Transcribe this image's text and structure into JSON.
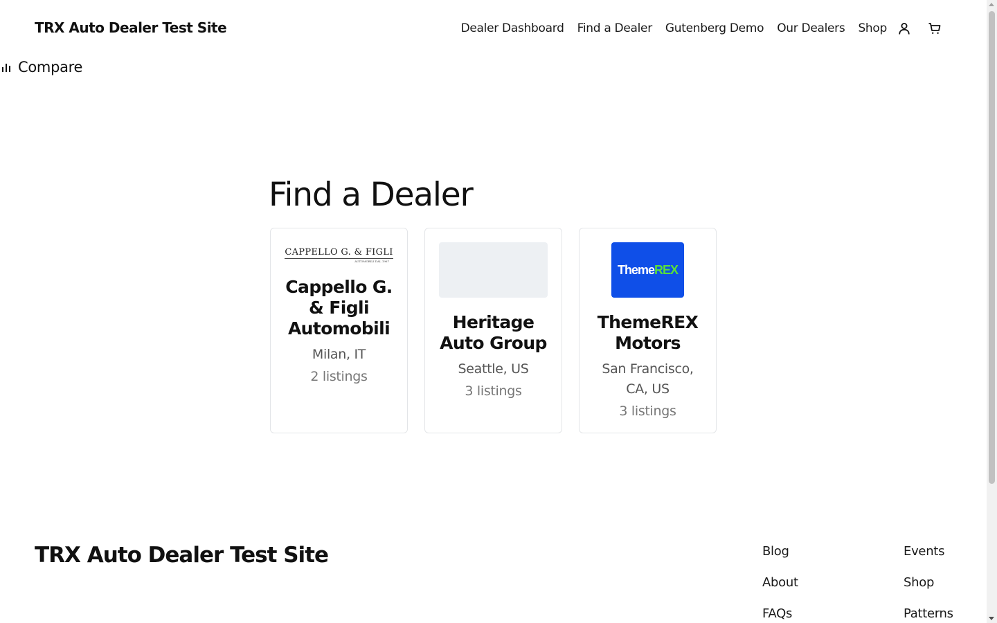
{
  "header": {
    "site_title": "TRX Auto Dealer Test Site",
    "nav": [
      "Dealer Dashboard",
      "Find a Dealer",
      "Gutenberg Demo",
      "Our Dealers",
      "Shop"
    ],
    "account_icon": "user-icon",
    "cart_icon": "cart-icon"
  },
  "compare": {
    "label": "Compare",
    "icon": "bar-chart-icon"
  },
  "page": {
    "title": "Find a Dealer"
  },
  "dealers": [
    {
      "name": "Cappello G. & Figli Automobili",
      "location": "Milan, IT",
      "listings": "2 listings",
      "logo_text": "CAPPELLO G. & FIGLI",
      "logo_subtext": "AUTOMOBILI DAL 1967"
    },
    {
      "name": "Heritage Auto Group",
      "location": "Seattle, US",
      "listings": "3 listings"
    },
    {
      "name": "ThemeREX Motors",
      "location": "San Francisco, CA, US",
      "listings": "3 listings",
      "logo_text_a": "Theme",
      "logo_text_b": "REX"
    }
  ],
  "footer": {
    "site_title": "TRX Auto Dealer Test Site",
    "col1": [
      "Blog",
      "About",
      "FAQs"
    ],
    "col2": [
      "Events",
      "Shop",
      "Patterns"
    ]
  },
  "colors": {
    "themerex_blue": "#0f4fe8",
    "themerex_green": "#58e03a",
    "card_border": "#e3e5e8",
    "placeholder": "#edf0f3"
  }
}
